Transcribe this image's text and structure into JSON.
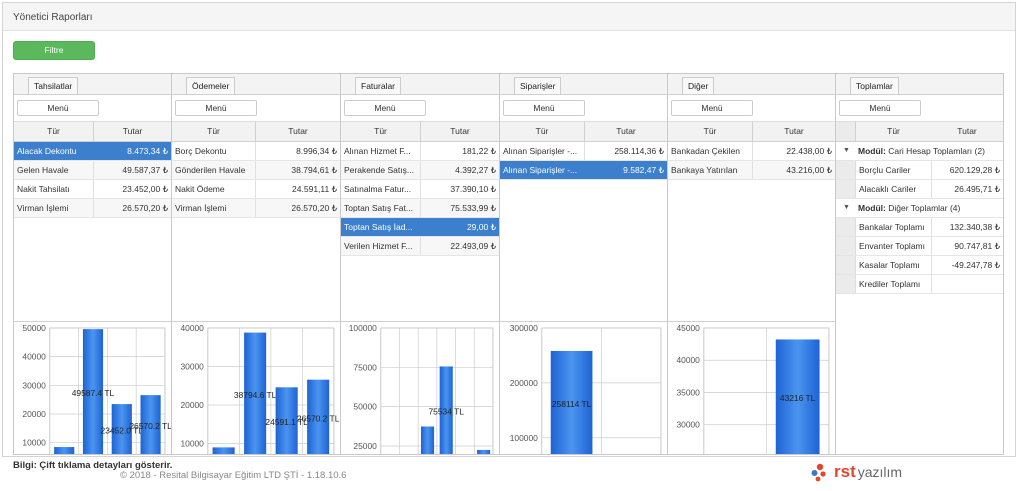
{
  "page": {
    "title": "Yönetici Raporları",
    "filter_label": "Filtre"
  },
  "menu_label": "Menü",
  "col_headers": {
    "type": "Tür",
    "amount": "Tutar"
  },
  "columns": [
    {
      "tab": "Tahsilatlar",
      "rows": [
        {
          "name": "Alacak Dekontu",
          "value": "8.473,34 ₺",
          "selected": true
        },
        {
          "name": "Gelen Havale",
          "value": "49.587,37 ₺"
        },
        {
          "name": "Nakit Tahsilatı",
          "value": "23.452,00 ₺"
        },
        {
          "name": "Virman İşlemi",
          "value": "26.570,20 ₺"
        }
      ]
    },
    {
      "tab": "Ödemeler",
      "rows": [
        {
          "name": "Borç Dekontu",
          "value": "8.996,34 ₺"
        },
        {
          "name": "Gönderilen Havale",
          "value": "38.794,61 ₺"
        },
        {
          "name": "Nakit Ödeme",
          "value": "24.591,11 ₺"
        },
        {
          "name": "Virman İşlemi",
          "value": "26.570,20 ₺"
        }
      ]
    },
    {
      "tab": "Faturalar",
      "rows": [
        {
          "name": "Alınan Hizmet F...",
          "value": "181,22 ₺"
        },
        {
          "name": "Perakende Satış...",
          "value": "4.392,27 ₺"
        },
        {
          "name": "Satınalma Fatur...",
          "value": "37.390,10 ₺"
        },
        {
          "name": "Toptan Satış Fat...",
          "value": "75.533,99 ₺"
        },
        {
          "name": "Toptan Satış İad...",
          "value": "29,00 ₺",
          "selected": true
        },
        {
          "name": "Verilen Hizmet F...",
          "value": "22.493,09 ₺"
        }
      ]
    },
    {
      "tab": "Siparişler",
      "rows": [
        {
          "name": "Alınan Siparişler -...",
          "value": "258.114,36 ₺"
        },
        {
          "name": "Alınan Siparişler -...",
          "value": "9.582,47 ₺",
          "selected": true
        }
      ]
    },
    {
      "tab": "Diğer",
      "rows": [
        {
          "name": "Bankadan Çekilen",
          "value": "22.438,00 ₺"
        },
        {
          "name": "Bankaya Yatırılan",
          "value": "43.216,00 ₺"
        }
      ]
    }
  ],
  "totals": {
    "tab": "Toplamlar",
    "groups": [
      {
        "label": "Modül:",
        "title": "Cari Hesap Toplamları (2)",
        "rows": [
          {
            "name": "Borçlu Cariler",
            "value": "620.129,28 ₺"
          },
          {
            "name": "Alacaklı Cariler",
            "value": "26.495,71 ₺"
          }
        ]
      },
      {
        "label": "Modül:",
        "title": "Diğer Toplamlar (4)",
        "rows": [
          {
            "name": "Bankalar Toplamı",
            "value": "132.340,38 ₺"
          },
          {
            "name": "Envanter Toplamı",
            "value": "90.747,81 ₺"
          },
          {
            "name": "Kasalar Toplamı",
            "value": "-49.247,78 ₺"
          },
          {
            "name": "Krediler Toplamı",
            "value": ""
          }
        ]
      }
    ]
  },
  "chart_data": [
    {
      "type": "bar",
      "yticks": [
        10000,
        20000,
        30000,
        40000,
        50000
      ],
      "ymin": 5000,
      "ymax": 50000,
      "bars": [
        {
          "value": 8473.34,
          "label": ""
        },
        {
          "value": 49587.4,
          "label": "49587.4 TL"
        },
        {
          "value": 23452,
          "label": "23452.0 TL"
        },
        {
          "value": 26570.2,
          "label": "26570.2 TL"
        }
      ]
    },
    {
      "type": "bar",
      "yticks": [
        10000,
        20000,
        30000,
        40000
      ],
      "ymin": 6500,
      "ymax": 40000,
      "bars": [
        {
          "value": 8996.34,
          "label": ""
        },
        {
          "value": 38794.6,
          "label": "38794.6 TL"
        },
        {
          "value": 24591.1,
          "label": "24591.1 TL"
        },
        {
          "value": 26570.2,
          "label": "26570.2 TL"
        }
      ]
    },
    {
      "type": "bar",
      "yticks": [
        25000,
        50000,
        75000,
        100000
      ],
      "ymin": 18000,
      "ymax": 100000,
      "bars": [
        {
          "value": 181.22,
          "label": ""
        },
        {
          "value": 4392.27,
          "label": ""
        },
        {
          "value": 37390.1,
          "label": ""
        },
        {
          "value": 75534,
          "label": "75534 TL"
        },
        {
          "value": 29,
          "label": ""
        },
        {
          "value": 22493.09,
          "label": ""
        }
      ]
    },
    {
      "type": "bar",
      "yticks": [
        100000,
        200000,
        300000
      ],
      "ymin": 65000,
      "ymax": 300000,
      "bars": [
        {
          "value": 258114,
          "label": "258114 TL"
        },
        {
          "value": 9582.47,
          "label": ""
        }
      ]
    },
    {
      "type": "bar",
      "yticks": [
        25000,
        30000,
        35000,
        40000,
        45000
      ],
      "ymin": 25000,
      "ymax": 45000,
      "bars": [
        {
          "value": 22438,
          "label": ""
        },
        {
          "value": 43216,
          "label": "43216 TL"
        }
      ]
    }
  ],
  "footer": {
    "info": "Bilgi: Çift tıklama detayları gösterir.",
    "copyright": "© 2018 - Resital Bilgisayar Eğitim LTD ŞTİ - 1.18.10.6",
    "logo_r": "rst",
    "logo_y": "yazılım"
  }
}
